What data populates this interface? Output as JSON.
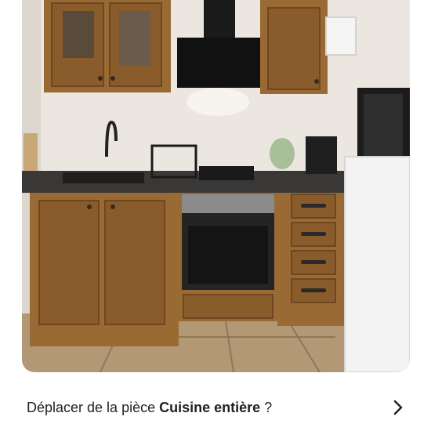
{
  "photo": {
    "subject": "kitchen-photo"
  },
  "prompt": {
    "prefix": "Déplacer de la pièce ",
    "room_name": "Cuisine entière",
    "suffix": " ?"
  },
  "icons": {
    "chevron": "chevron-right-icon"
  },
  "colors": {
    "wood": "#9a6a35",
    "wood_dark": "#6e4620",
    "countertop": "#3a3836",
    "wall": "#ece8e1",
    "floor": "#b59a78",
    "text": "#222222"
  }
}
